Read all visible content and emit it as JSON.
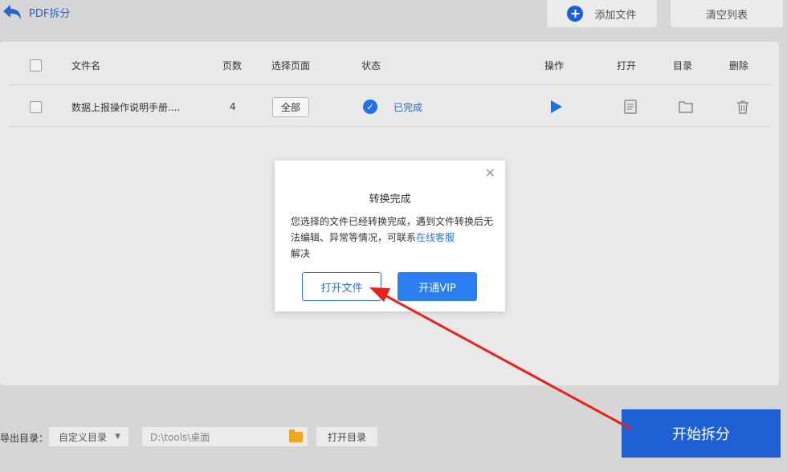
{
  "header": {
    "back_title": "PDF拆分",
    "add_file_label": "添加文件",
    "clear_list_label": "清空列表"
  },
  "table": {
    "columns": [
      "文件名",
      "页数",
      "选择页面",
      "状态",
      "操作",
      "打开",
      "目录",
      "删除"
    ],
    "rows": [
      {
        "name": "数据上报操作说明手册....",
        "pages": "4",
        "range": "全部",
        "status": "已完成"
      }
    ]
  },
  "modal": {
    "title": "转换完成",
    "body_text": "您选择的文件已经转换完成，遇到文件转换后无法编辑、异常等情况，可联系",
    "link_text": "在线客服",
    "body_tail": "解决",
    "open_file_label": "打开文件",
    "vip_label": "开通VIP"
  },
  "footer": {
    "output_label": "导出目录：",
    "dir_option": "自定义目录",
    "path_value": "D:\\tools\\桌面",
    "open_dir_label": "打开目录",
    "start_label": "开始拆分"
  },
  "colors": {
    "accent": "#1f5fd4",
    "link": "#2b72e0",
    "annotation_arrow": "#e8211b"
  }
}
